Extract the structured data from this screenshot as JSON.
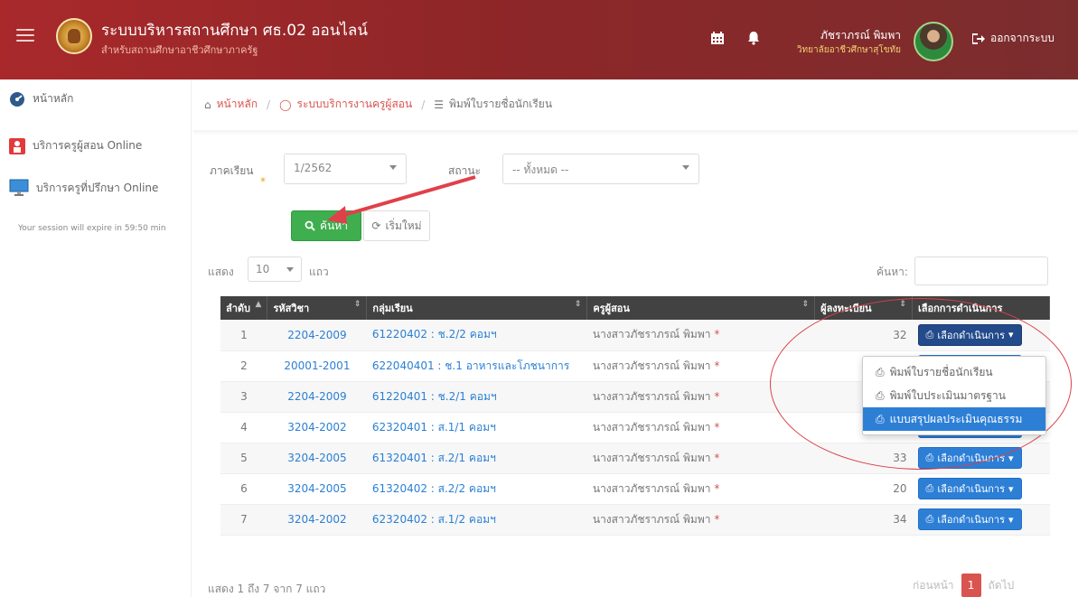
{
  "header": {
    "title": "ระบบบริหารสถานศึกษา ศธ.02 ออนไลน์",
    "subtitle": "สำหรับสถานศึกษาอาชีวศึกษาภาครัฐ",
    "user_name": "ภัชราภรณ์ พิมพา",
    "user_school": "วิทยาลัยอาชีวศึกษาสุโขทัย",
    "logout_label": "ออกจากระบบ"
  },
  "sidebar": {
    "items": [
      {
        "label": "หน้าหลัก",
        "icon": "dashboard-icon"
      },
      {
        "label": "บริการครูผู้สอน Online",
        "icon": "teacher-icon"
      },
      {
        "label": "บริการครูที่ปรึกษา Online",
        "icon": "monitor-icon"
      }
    ],
    "session_text": "Your session will expire in 59:50 min"
  },
  "breadcrumb": {
    "home": "หน้าหลัก",
    "section": "ระบบบริการงานครูผู้สอน",
    "current": "พิมพ์ใบรายชื่อนักเรียน"
  },
  "filters": {
    "semester_label": "ภาคเรียน",
    "semester_required": "*",
    "semester_value": "1/2562",
    "status_label": "สถานะ",
    "status_value": "-- ทั้งหมด --",
    "search_button": "ค้นหา",
    "reset_button": "เริ่มใหม่"
  },
  "table_controls": {
    "show_label": "แสดง",
    "page_length": "10",
    "unit_label": "แถว",
    "search_label": "ค้นหา:"
  },
  "table": {
    "headers": [
      "ลำดับ",
      "รหัสวิชา",
      "กลุ่มเรียน",
      "ครูผู้สอน",
      "ผู้ลงทะเบียน",
      "เลือกการดำเนินการ"
    ],
    "rows": [
      {
        "no": "1",
        "code": "2204-2009",
        "group": "61220402 : ช.2/2 คอมฯ",
        "teacher": "นางสาวภัชราภรณ์ พิมพา",
        "count": "32"
      },
      {
        "no": "2",
        "code": "20001-2001",
        "group": "622040401 : ช.1 อาหารและโภชนาการ",
        "teacher": "นางสาวภัชราภรณ์ พิมพา",
        "count": ""
      },
      {
        "no": "3",
        "code": "2204-2009",
        "group": "61220401 : ช.2/1 คอมฯ",
        "teacher": "นางสาวภัชราภรณ์ พิมพา",
        "count": ""
      },
      {
        "no": "4",
        "code": "3204-2002",
        "group": "62320401 : ส.1/1 คอมฯ",
        "teacher": "นางสาวภัชราภรณ์ พิมพา",
        "count": "20"
      },
      {
        "no": "5",
        "code": "3204-2005",
        "group": "61320401 : ส.2/1 คอมฯ",
        "teacher": "นางสาวภัชราภรณ์ พิมพา",
        "count": "33"
      },
      {
        "no": "6",
        "code": "3204-2005",
        "group": "61320402 : ส.2/2 คอมฯ",
        "teacher": "นางสาวภัชราภรณ์ พิมพา",
        "count": "20"
      },
      {
        "no": "7",
        "code": "3204-2002",
        "group": "62320402 : ส.1/2 คอมฯ",
        "teacher": "นางสาวภัชราภรณ์ พิมพา",
        "count": "34"
      }
    ],
    "action_label": "เลือกดำเนินการ",
    "required_mark": "*"
  },
  "dropdown": {
    "items": [
      "พิมพ์ใบรายชื่อนักเรียน",
      "พิมพ์ใบประเมินมาตรฐาน",
      "แบบสรุปผลประเมินคุณธรรม"
    ]
  },
  "footer": {
    "info": "แสดง 1 ถึง 7 จาก 7 แถว",
    "prev": "ก่อนหน้า",
    "current_page": "1",
    "next": "ถัดไป"
  },
  "colors": {
    "header": "#8e2628",
    "accent_red": "#d9534f",
    "search_green": "#3fae4f",
    "action_blue": "#2d7fd6",
    "table_header": "#424242"
  }
}
